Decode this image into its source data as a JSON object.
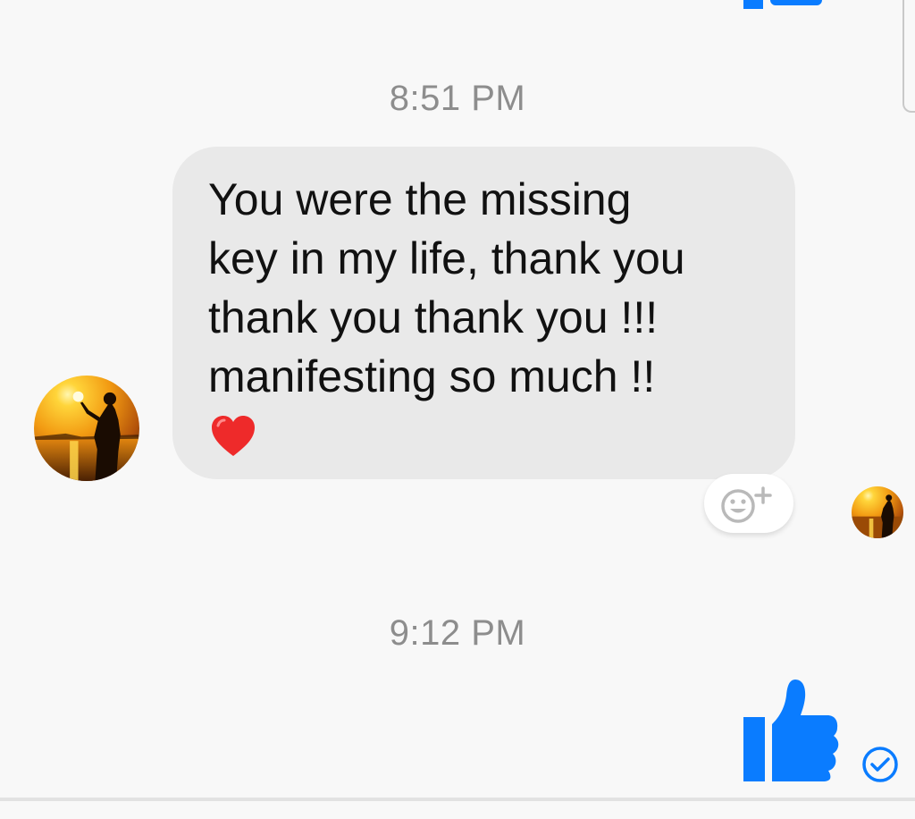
{
  "timestamps": {
    "first": "8:51 PM",
    "second": "9:12 PM"
  },
  "message": {
    "text": "You were the missing\nkey in my life, thank you\nthank you thank you !!!\nmanifesting so much !!",
    "emoji": "heart"
  },
  "reaction_button": {
    "icon": "add-reaction-icon"
  },
  "like_message": {
    "icon": "thumbs-up-icon"
  },
  "seen_status": {
    "icon": "check-circle-icon"
  },
  "colors": {
    "accent": "#0a7cff",
    "bubble": "#e9e9e9",
    "timestamp": "#8d8d8d",
    "background": "#f8f8f8",
    "heart": "#ee2a2a"
  }
}
